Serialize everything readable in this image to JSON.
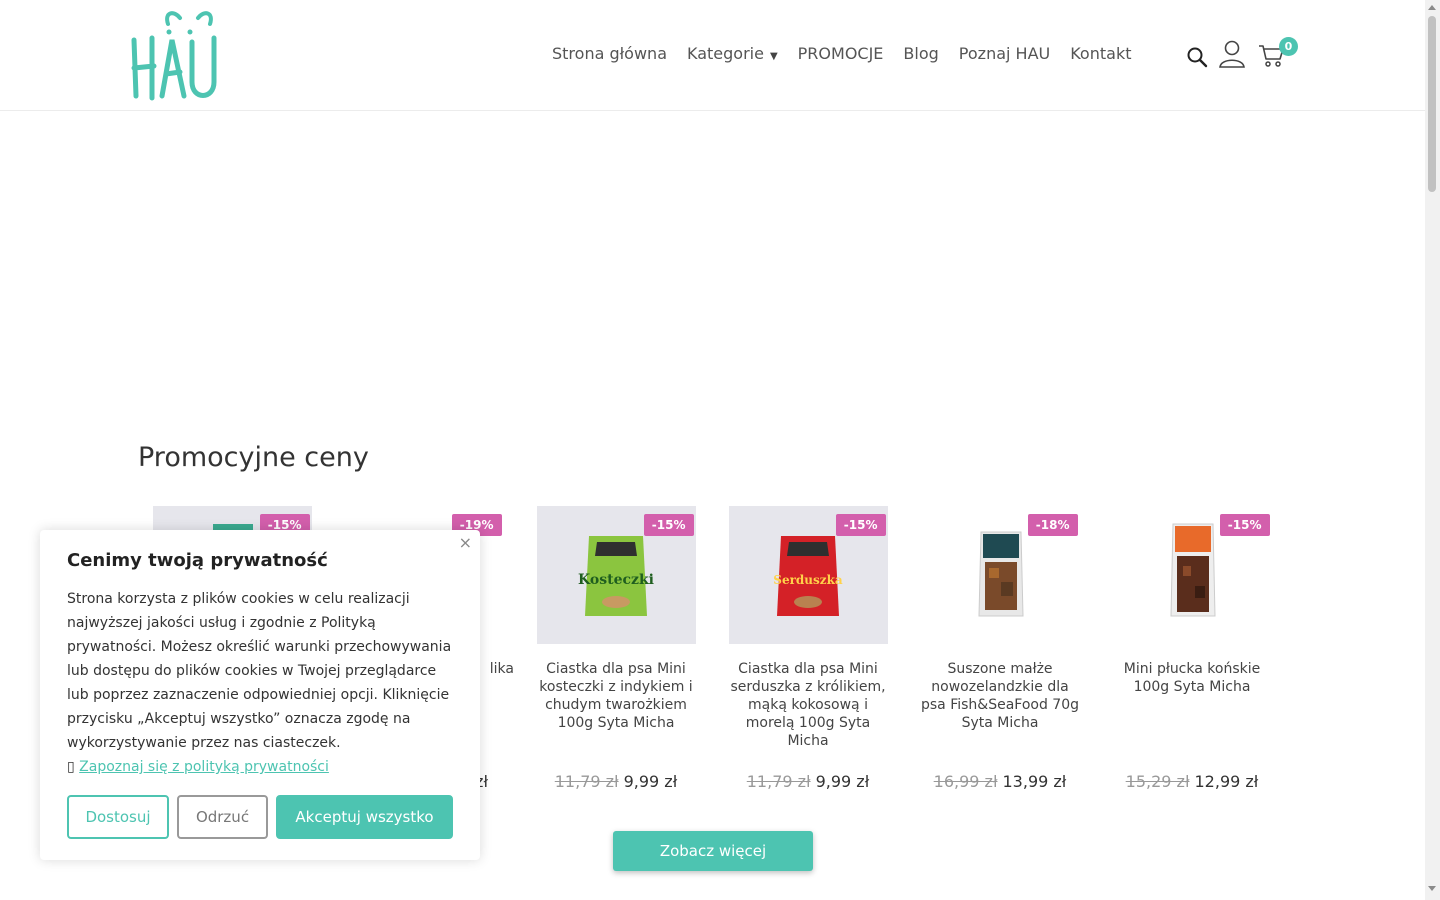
{
  "brand": {
    "logo_text": "HAU"
  },
  "nav": {
    "items": [
      {
        "label": "Strona główna"
      },
      {
        "label": "Kategorie"
      },
      {
        "label": "PROMOCJE"
      },
      {
        "label": "Blog"
      },
      {
        "label": "Poznaj HAU"
      },
      {
        "label": "Kontakt"
      }
    ]
  },
  "header": {
    "cart_count": "0"
  },
  "section": {
    "title": "Promocyjne ceny",
    "more_button": "Zobacz więcej"
  },
  "products": [
    {
      "badge": "-15%",
      "name": "",
      "old_price": "",
      "new_price": ""
    },
    {
      "badge": "-19%",
      "name": "lika",
      "old_price": "",
      "new_price": "zł"
    },
    {
      "badge": "-15%",
      "name": "Ciastka dla psa Mini kosteczki z indykiem i chudym twarożkiem 100g Syta Micha",
      "old_price": "11,79 zł",
      "new_price": "9,99 zł"
    },
    {
      "badge": "-15%",
      "name": "Ciastka dla psa Mini serduszka z królikiem, mąką kokosową i morelą 100g Syta Micha",
      "old_price": "11,79 zł",
      "new_price": "9,99 zł"
    },
    {
      "badge": "-18%",
      "name": "Suszone małże nowozelandzkie dla psa Fish&SeaFood 70g Syta Micha",
      "old_price": "16,99 zł",
      "new_price": "13,99 zł"
    },
    {
      "badge": "-15%",
      "name": "Mini płucka końskie 100g Syta Micha",
      "old_price": "15,29 zł",
      "new_price": "12,99 zł"
    }
  ],
  "cookie": {
    "title": "Cenimy twoją prywatność",
    "text": " Strona korzysta z plików cookies w celu realizacji najwyższej jakości usług i zgodnie z Polityką prywatności. Możesz określić warunki przechowywania lub dostępu do plików cookies w Twojej przeglądarce lub poprzez zaznaczenie odpowiedniej opcji. Kliknięcie przycisku „Akceptuj wszystko” oznacza zgodę na wykorzystywanie przez nas ciasteczek.",
    "link_glyph": "▯",
    "link": "Zapoznaj się z polityką prywatności",
    "close": "×",
    "customize": "Dostosuj",
    "reject": "Odrzuć",
    "accept": "Akceptuj wszystko"
  },
  "colors": {
    "accent": "#4dc4b1",
    "badge": "#d35fac"
  },
  "icons": [
    "search-icon",
    "user-icon",
    "cart-icon",
    "close-icon",
    "chevron-down-icon"
  ]
}
